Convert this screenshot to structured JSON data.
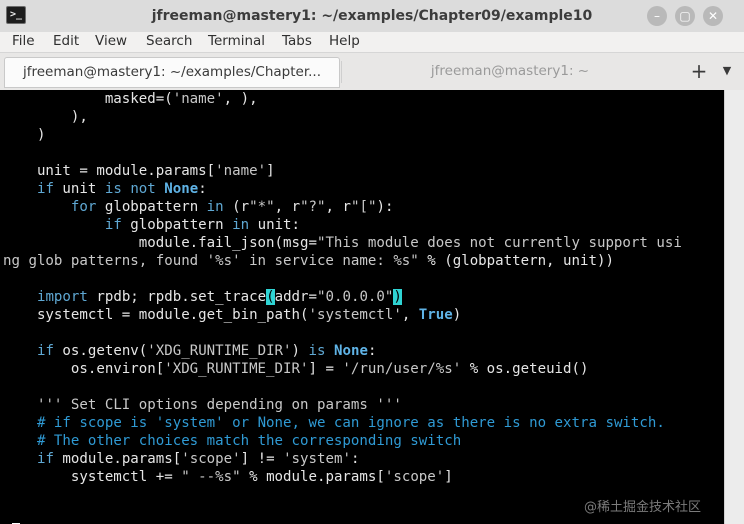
{
  "window": {
    "title": "jfreeman@mastery1: ~/examples/Chapter09/example10",
    "icon": "terminal-icon",
    "controls": [
      {
        "icon": "minimize-icon",
        "glyph": "–"
      },
      {
        "icon": "maximize-icon",
        "glyph": "▢"
      },
      {
        "icon": "close-icon",
        "glyph": "✕"
      }
    ]
  },
  "menu": [
    "File",
    "Edit",
    "View",
    "Search",
    "Terminal",
    "Tabs",
    "Help"
  ],
  "tabs": [
    {
      "label": "jfreeman@mastery1: ~/examples/Chapter...",
      "active": true
    },
    {
      "label": "jfreeman@mastery1: ~",
      "active": false
    }
  ],
  "tab_actions": {
    "new_tab": "+",
    "menu": "▼"
  },
  "terminal": {
    "lines": [
      [
        [
          "            masked=(",
          ""
        ],
        [
          "'name'",
          "str"
        ],
        [
          ", ),",
          ""
        ]
      ],
      [
        [
          "        ),",
          ""
        ]
      ],
      [
        [
          "    )",
          ""
        ]
      ],
      [
        [
          "",
          ""
        ]
      ],
      [
        [
          "    unit = module.params[",
          ""
        ],
        [
          "'name'",
          "str"
        ],
        [
          "]",
          ""
        ]
      ],
      [
        [
          "    ",
          ""
        ],
        [
          "if",
          "kw"
        ],
        [
          " unit ",
          ""
        ],
        [
          "is not",
          "kw"
        ],
        [
          " ",
          ""
        ],
        [
          "None",
          "kwb"
        ],
        [
          ":",
          ""
        ]
      ],
      [
        [
          "        ",
          ""
        ],
        [
          "for",
          "kw"
        ],
        [
          " globpattern ",
          ""
        ],
        [
          "in",
          "kw"
        ],
        [
          " (r",
          ""
        ],
        [
          "\"*\"",
          "str"
        ],
        [
          ", r",
          ""
        ],
        [
          "\"?\"",
          "str"
        ],
        [
          ", r",
          ""
        ],
        [
          "\"[\"",
          "str"
        ],
        [
          "):",
          ""
        ]
      ],
      [
        [
          "            ",
          ""
        ],
        [
          "if",
          "kw"
        ],
        [
          " globpattern ",
          ""
        ],
        [
          "in",
          "kw"
        ],
        [
          " unit:",
          ""
        ]
      ],
      [
        [
          "                module.fail_json(msg=",
          ""
        ],
        [
          "\"This module does not currently support usi",
          "str"
        ]
      ],
      [
        [
          "ng glob patterns, found '%s' in service name: %s\"",
          "str"
        ],
        [
          " % (globpattern, unit))",
          ""
        ]
      ],
      [
        [
          "",
          ""
        ]
      ],
      [
        [
          "    ",
          ""
        ],
        [
          "import",
          "kw"
        ],
        [
          " rpdb; rpdb.set_trace",
          ""
        ],
        [
          "(",
          "hl"
        ],
        [
          "addr=",
          ""
        ],
        [
          "\"0.0.0.0\"",
          "str"
        ],
        [
          ")",
          "hl"
        ]
      ],
      [
        [
          "    systemctl = module.get_bin_path(",
          ""
        ],
        [
          "'systemctl'",
          "str"
        ],
        [
          ", ",
          ""
        ],
        [
          "True",
          "kwb"
        ],
        [
          ")",
          ""
        ]
      ],
      [
        [
          "",
          ""
        ]
      ],
      [
        [
          "    ",
          ""
        ],
        [
          "if",
          "kw"
        ],
        [
          " os.getenv(",
          ""
        ],
        [
          "'XDG_RUNTIME_DIR'",
          "str"
        ],
        [
          ") ",
          ""
        ],
        [
          "is",
          "kw"
        ],
        [
          " ",
          ""
        ],
        [
          "None",
          "kwb"
        ],
        [
          ":",
          ""
        ]
      ],
      [
        [
          "        os.environ[",
          ""
        ],
        [
          "'XDG_RUNTIME_DIR'",
          "str"
        ],
        [
          "] = ",
          ""
        ],
        [
          "'/run/user/%s'",
          "str"
        ],
        [
          " % os.geteuid()",
          ""
        ]
      ],
      [
        [
          "",
          ""
        ]
      ],
      [
        [
          "    ",
          ""
        ],
        [
          "''' Set CLI options depending on params '''",
          "str"
        ]
      ],
      [
        [
          "    ",
          ""
        ],
        [
          "# if scope is 'system' or None, we can ignore as there is no extra switch.",
          "cm"
        ]
      ],
      [
        [
          "    ",
          ""
        ],
        [
          "# The other choices match the corresponding switch",
          "cm"
        ]
      ],
      [
        [
          "    ",
          ""
        ],
        [
          "if",
          "kw"
        ],
        [
          " module.params[",
          ""
        ],
        [
          "'scope'",
          "str"
        ],
        [
          "] != ",
          ""
        ],
        [
          "'system'",
          "str"
        ],
        [
          ":",
          ""
        ]
      ],
      [
        [
          "        systemctl += ",
          ""
        ],
        [
          "\" --%s\"",
          "str"
        ],
        [
          " % module.params[",
          ""
        ],
        [
          "'scope'",
          "str"
        ],
        [
          "]",
          ""
        ]
      ],
      [
        [
          "",
          ""
        ]
      ],
      [
        [
          "",
          ""
        ]
      ],
      [
        [
          ":",
          ""
        ]
      ]
    ]
  },
  "watermark": "@稀土掘金技术社区"
}
